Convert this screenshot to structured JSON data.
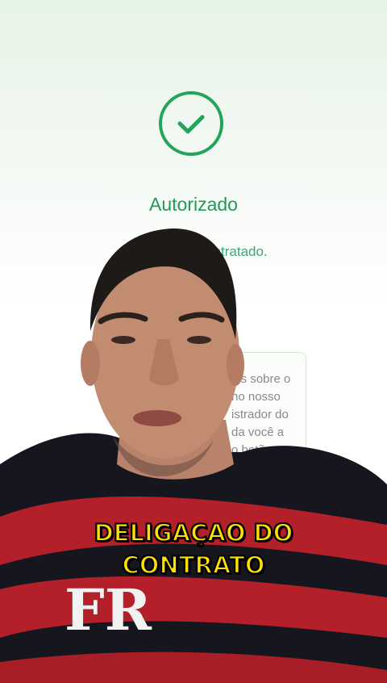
{
  "status": {
    "title": "Autorizado",
    "subtitle": "Agora ... dor contratado."
  },
  "info_card": {
    "lines": [
      "les sobre o",
      "no nosso",
      "istrador do",
      "da você a",
      "o botão"
    ]
  },
  "caption": {
    "line1": "DELIGAÇAO DO",
    "line2": "CONTRATO"
  },
  "colors": {
    "accent": "#24a35a",
    "caption_text": "#ffe000",
    "shirt_red": "#b5202a",
    "shirt_black": "#15151d"
  }
}
